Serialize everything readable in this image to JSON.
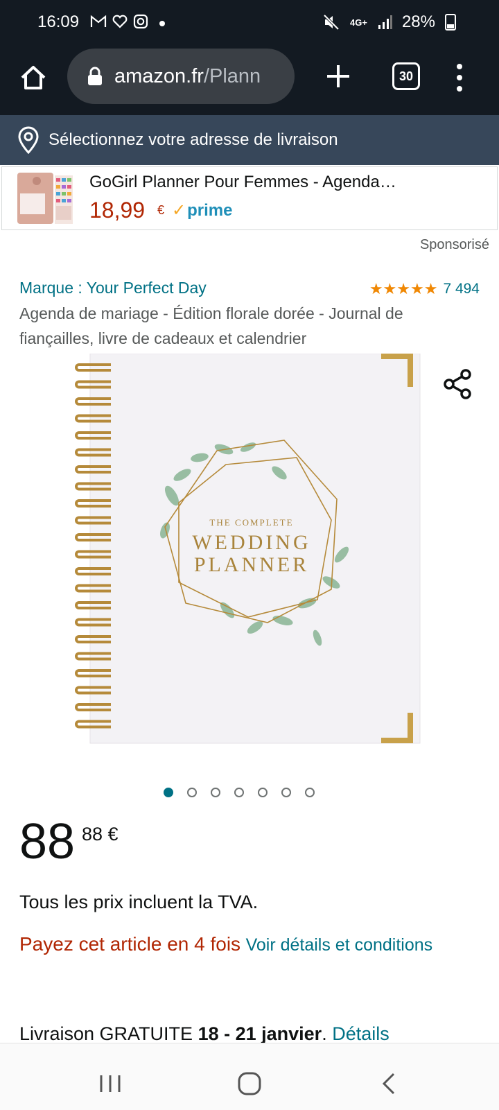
{
  "status_bar": {
    "time": "16:09",
    "network": "4G+",
    "battery": "28%"
  },
  "browser": {
    "url_domain": "amazon.fr",
    "url_path": "/Plann",
    "tab_count": "30"
  },
  "delivery_bar": {
    "text": "Sélectionnez votre adresse de livraison"
  },
  "sponsored_ad": {
    "title": "GoGirl Planner Pour Femmes - Agenda…",
    "price": "18,99",
    "currency": "€",
    "prime_label": "prime",
    "sponsored_label": "Sponsorisé"
  },
  "product": {
    "brand": "Marque : Your Perfect Day",
    "rating_stars": 5,
    "rating_count": "7 494",
    "title": "Agenda de mariage - Édition florale dorée - Journal de fiançailles, livre de cadeaux et calendrier",
    "cover_line1": "THE COMPLETE",
    "cover_line2": "WEDDING",
    "cover_line3": "PLANNER",
    "image_count": 7,
    "active_image": 1
  },
  "pricing": {
    "whole": "88",
    "fraction": "88 €",
    "tva_note": "Tous les prix incluent la TVA.",
    "installments": "Payez cet article en 4 fois",
    "installments_link": "Voir détails et conditions"
  },
  "shipping": {
    "prefix": "Livraison GRATUITE",
    "dates": "18 - 21 janvier",
    "link": "Détails"
  },
  "colors": {
    "header_bg": "#131a22",
    "delivery_bg": "#37475a",
    "link": "#007185",
    "price_red": "#b12704",
    "star": "#f08804",
    "gold": "#c8a14a"
  }
}
